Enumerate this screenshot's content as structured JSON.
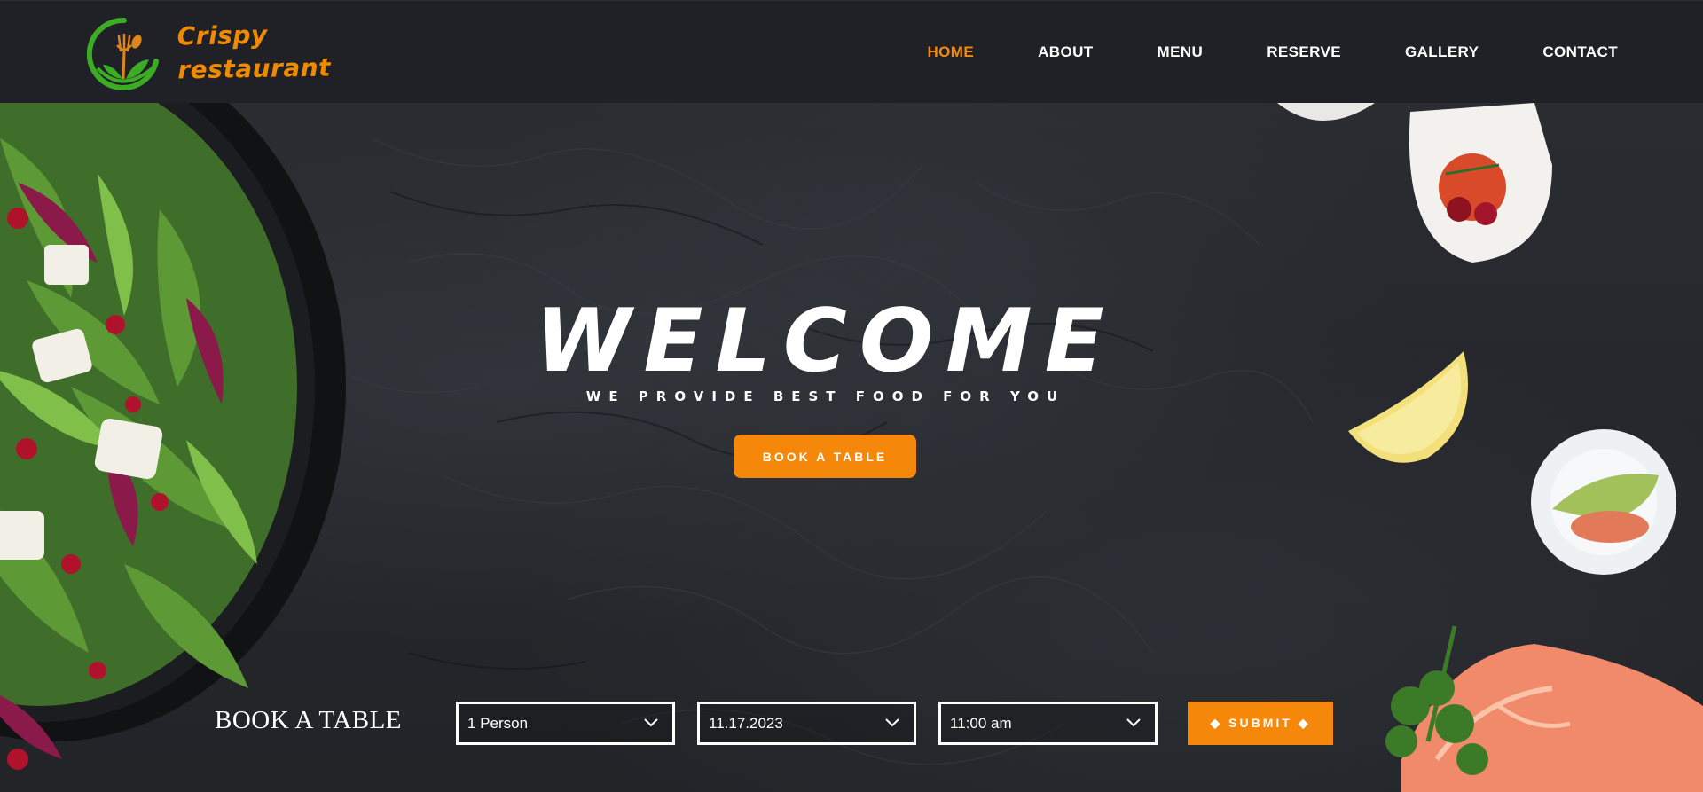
{
  "brand": {
    "name_line1": "Crispy",
    "name_line2": "restaurant",
    "logo_icon": "fork-spoon-leaf-icon",
    "accent_color": "#f58a07",
    "logo_green": "#3dac25"
  },
  "nav": {
    "items": [
      {
        "label": "HOME",
        "active": true
      },
      {
        "label": "ABOUT",
        "active": false
      },
      {
        "label": "MENU",
        "active": false
      },
      {
        "label": "RESERVE",
        "active": false
      },
      {
        "label": "GALLERY",
        "active": false
      },
      {
        "label": "CONTACT",
        "active": false
      }
    ]
  },
  "hero": {
    "title": "WELCOME",
    "tagline": "WE PROVIDE BEST FOOD FOR YOU",
    "cta_label": "BOOK A TABLE"
  },
  "booking": {
    "title": "BOOK A TABLE",
    "guests": {
      "value": "1 Person",
      "icon": "chevron-down-icon"
    },
    "date": {
      "value": "11.17.2023",
      "icon": "chevron-down-icon"
    },
    "time": {
      "value": "11:00 am",
      "icon": "chevron-down-icon"
    },
    "submit_label": "◆ SUBMIT ◆"
  }
}
